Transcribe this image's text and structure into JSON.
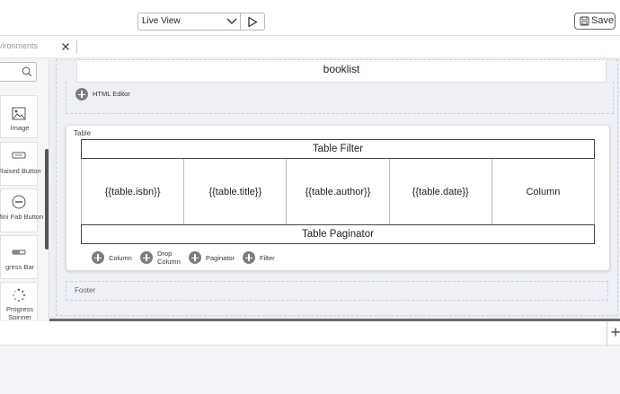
{
  "topbar": {
    "view_select": "Live View",
    "save_label": "Save"
  },
  "tabbar": {
    "env_tab": "vironments"
  },
  "sidebar": {
    "items": [
      {
        "label": "Image",
        "icon": "image-icon"
      },
      {
        "label": "Raised Button",
        "icon": "raised-button-icon"
      },
      {
        "label": "Mini Fab Button",
        "icon": "mini-fab-icon"
      },
      {
        "label": "gress Bar",
        "icon": "progress-bar-icon"
      },
      {
        "label": "Progress Spinner",
        "icon": "progress-spinner-icon"
      }
    ]
  },
  "page": {
    "title": "booklist",
    "html_editor_label": "HTML Editor"
  },
  "table": {
    "label": "Table",
    "filter_label": "Table Filter",
    "columns": [
      "{{table.isbn}}",
      "{{table.title}}",
      "{{table.author}}",
      "{{table.date}}",
      "Column"
    ],
    "paginator_label": "Table Paginator",
    "actions": {
      "column": "Column",
      "drop_column_1": "Drop",
      "drop_column_2": "Column",
      "paginator": "Paginator",
      "filter": "Filter"
    }
  },
  "footer": {
    "label": "Footer"
  },
  "colors": {
    "accent": "#7d7d7d",
    "canvas_bg": "#eceef4",
    "divider": "#6a6a6a"
  }
}
